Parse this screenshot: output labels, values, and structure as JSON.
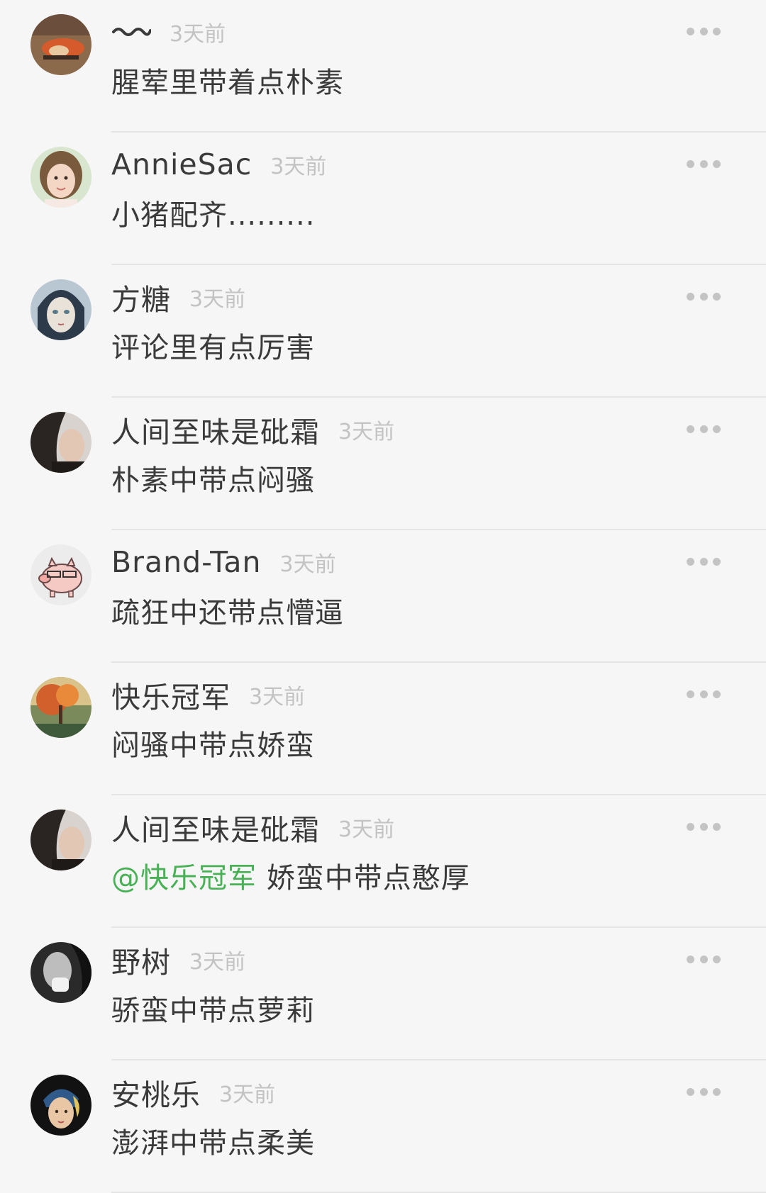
{
  "colors": {
    "mention": "#48b155",
    "timestamp": "#c3c3c3",
    "text": "#3a3a3a",
    "divider": "#e6e5e6",
    "background": "#f7f6f7"
  },
  "comments": [
    {
      "name": "〰",
      "name_icon": "wave-icon",
      "time": "3天前",
      "text": "腥荤里带着点朴素",
      "avatar": "avatar-food-photo"
    },
    {
      "name": "AnnieSac",
      "time": "3天前",
      "text": "小猪配齐.........",
      "avatar": "avatar-girl-photo"
    },
    {
      "name": "方糖",
      "time": "3天前",
      "text": "评论里有点厉害",
      "avatar": "avatar-illustrated-face"
    },
    {
      "name": "人间至味是砒霜",
      "time": "3天前",
      "text": "朴素中带点闷骚",
      "avatar": "avatar-dark-hair-photo"
    },
    {
      "name": "Brand-Tan",
      "time": "3天前",
      "text": "疏狂中还带点懵逼",
      "avatar": "avatar-pig-cartoon"
    },
    {
      "name": "快乐冠军",
      "time": "3天前",
      "text": "闷骚中带点娇蛮",
      "avatar": "avatar-autumn-painting"
    },
    {
      "name": "人间至味是砒霜",
      "time": "3天前",
      "mention": "@快乐冠军",
      "text": "娇蛮中带点憨厚",
      "avatar": "avatar-dark-hair-photo"
    },
    {
      "name": "野树",
      "time": "3天前",
      "text": "骄蛮中带点萝莉",
      "avatar": "avatar-bw-portrait"
    },
    {
      "name": "安桃乐",
      "time": "3天前",
      "text": "澎湃中带点柔美",
      "avatar": "avatar-pearl-earring-painting"
    }
  ]
}
